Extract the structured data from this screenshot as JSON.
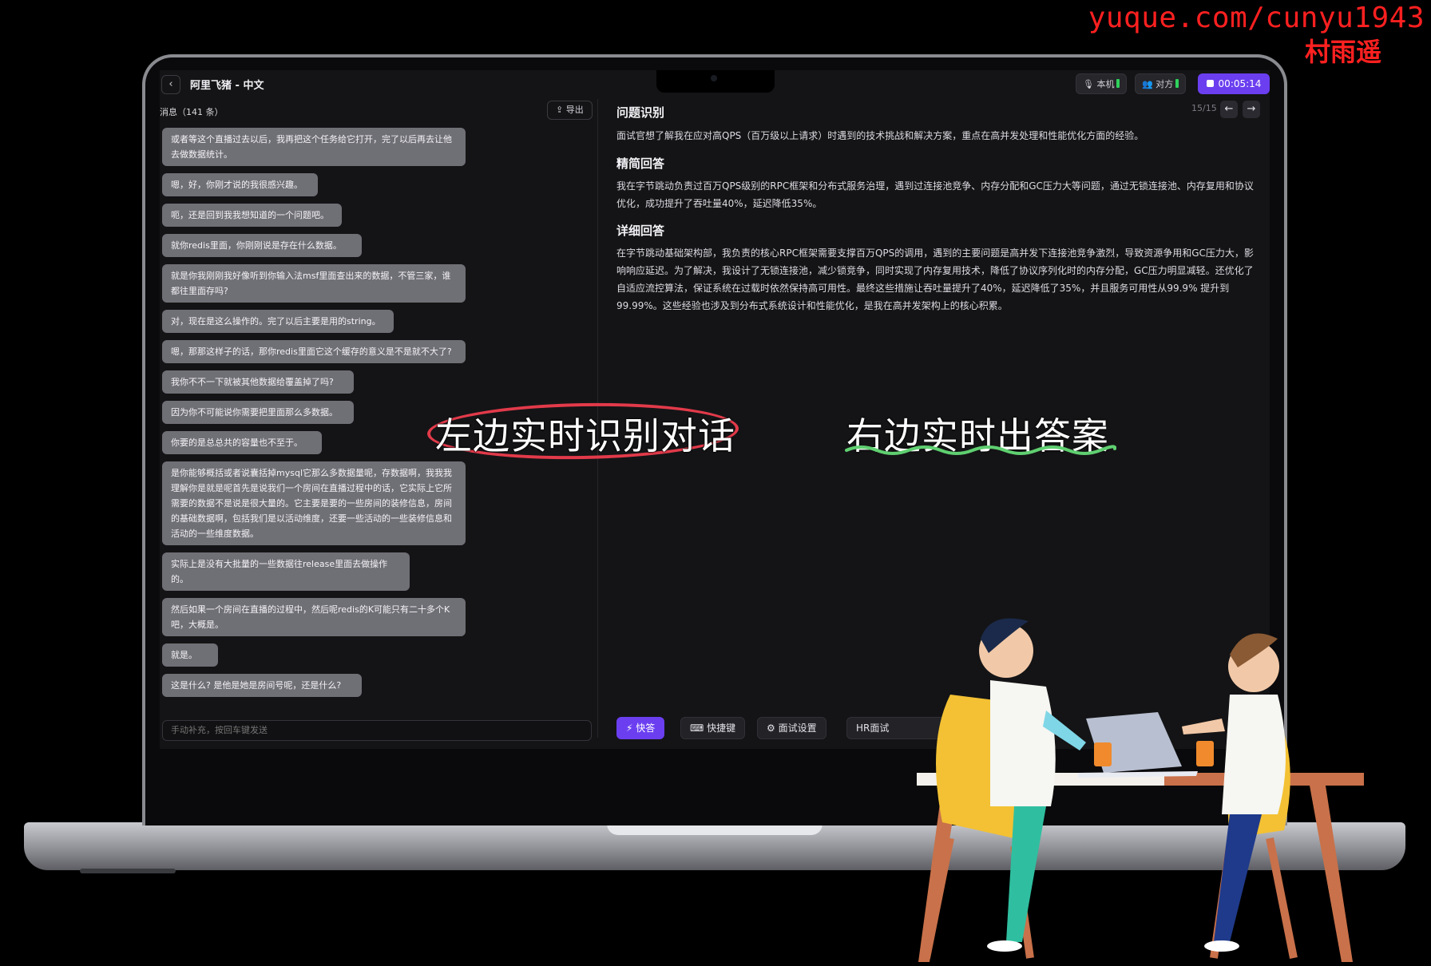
{
  "watermark": {
    "url": "yuque.com/cunyu1943",
    "name": "村雨遥"
  },
  "topbar": {
    "title": "阿里飞猪 - 中文",
    "mic_local": "本机",
    "mic_remote": "对方",
    "timer": "00:05:14"
  },
  "left": {
    "header": "消息（141 条）",
    "export_label": "导出",
    "input_placeholder": "手动补充，按回车键发送",
    "messages": [
      "或者等这个直播过去以后，我再把这个任务给它打开，完了以后再去让他去做数据统计。",
      "嗯，好，你刚才说的我很感兴趣。",
      "呃，还是回到我我想知道的一个问题吧。",
      "就你redis里面，你刚刚说是存在什么数据。",
      "就是你我刚刚我好像听到你输入法msf里面查出来的数据，不管三家，谁都往里面存吗?",
      "对，现在是这么操作的。完了以后主要是用的string。",
      "嗯，那那这样子的话，那你redis里面它这个缓存的意义是不是就不大了?",
      "我你不不一下就被其他数据给覆盖掉了吗?",
      "因为你不可能说你需要把里面那么多数据。",
      "你要的是总总共的容量也不至于。",
      "是你能够概括或者说囊括掉mysql它那么多数据量呢，存数据啊，我我我理解你是就是呢首先是说我们一个房间在直播过程中的话，它实际上它所需要的数据不是说是很大量的。它主要是要的一些房间的装修信息，房间的基础数据啊，包括我们是以活动维度，还要一些活动的一些装修信息和活动的一些维度数据。",
      "实际上是没有大批量的一些数据往release里面去做操作的。",
      "然后如果一个房间在直播的过程中，然后呢redis的K可能只有二十多个K吧，大概是。",
      "就是。",
      "这是什么? 是他是她是房间号呢，还是什么?"
    ]
  },
  "right": {
    "pager": "15/15",
    "sections": [
      {
        "title": "问题识别",
        "body": "面试官想了解我在应对高QPS（百万级以上请求）时遇到的技术挑战和解决方案，重点在高并发处理和性能优化方面的经验。"
      },
      {
        "title": "精简回答",
        "body": "我在字节跳动负责过百万QPS级别的RPC框架和分布式服务治理，遇到过连接池竞争、内存分配和GC压力大等问题，通过无锁连接池、内存复用和协议优化，成功提升了吞吐量40%，延迟降低35%。"
      },
      {
        "title": "详细回答",
        "body": "在字节跳动基础架构部，我负责的核心RPC框架需要支撑百万QPS的调用，遇到的主要问题是高并发下连接池竞争激烈，导致资源争用和GC压力大，影响响应延迟。为了解决，我设计了无锁连接池，减少锁竞争，同时实现了内存复用技术，降低了协议序列化时的内存分配，GC压力明显减轻。还优化了自适应流控算法，保证系统在过载时依然保持高可用性。最终这些措施让吞吐量提升了40%，延迟降低了35%，并且服务可用性从99.9% 提升到99.99%。这些经验也涉及到分布式系统设计和性能优化，是我在高并发架构上的核心积累。"
      }
    ],
    "bottom": {
      "quick_answer": "快答",
      "shortcuts": "快捷键",
      "settings": "面试设置",
      "mode": "HR面试"
    }
  },
  "captions": {
    "left": "左边实时识别对话",
    "right": "右边实时出答案"
  },
  "colors": {
    "accent": "#6b3ff0",
    "bubble": "#6f6f76",
    "watermark": "#ff2020",
    "level": "#2fd15c"
  }
}
